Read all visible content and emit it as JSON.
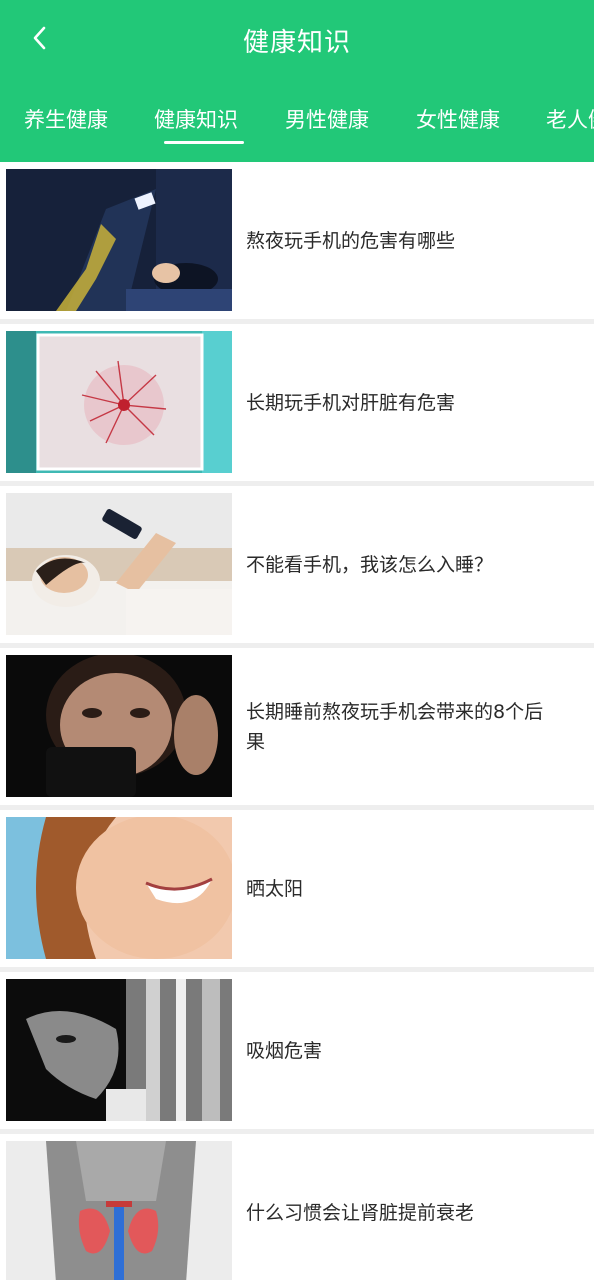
{
  "header": {
    "title": "健康知识",
    "back_icon": "chevron-left-icon",
    "background": "#22c878"
  },
  "tabs": [
    {
      "label": "养生健康",
      "active": false
    },
    {
      "label": "健康知识",
      "active": true
    },
    {
      "label": "男性健康",
      "active": false
    },
    {
      "label": "女性健康",
      "active": false
    },
    {
      "label": "老人健",
      "active": false
    }
  ],
  "articles": [
    {
      "title": "熬夜玩手机的危害有哪些"
    },
    {
      "title": "长期玩手机对肝脏有危害"
    },
    {
      "title": "不能看手机，我该怎么入睡？"
    },
    {
      "title": "长期睡前熬夜玩手机会带来的8个后果"
    },
    {
      "title": "晒太阳"
    },
    {
      "title": "吸烟危害"
    },
    {
      "title": "什么习惯会让肾脏提前衰老"
    }
  ]
}
